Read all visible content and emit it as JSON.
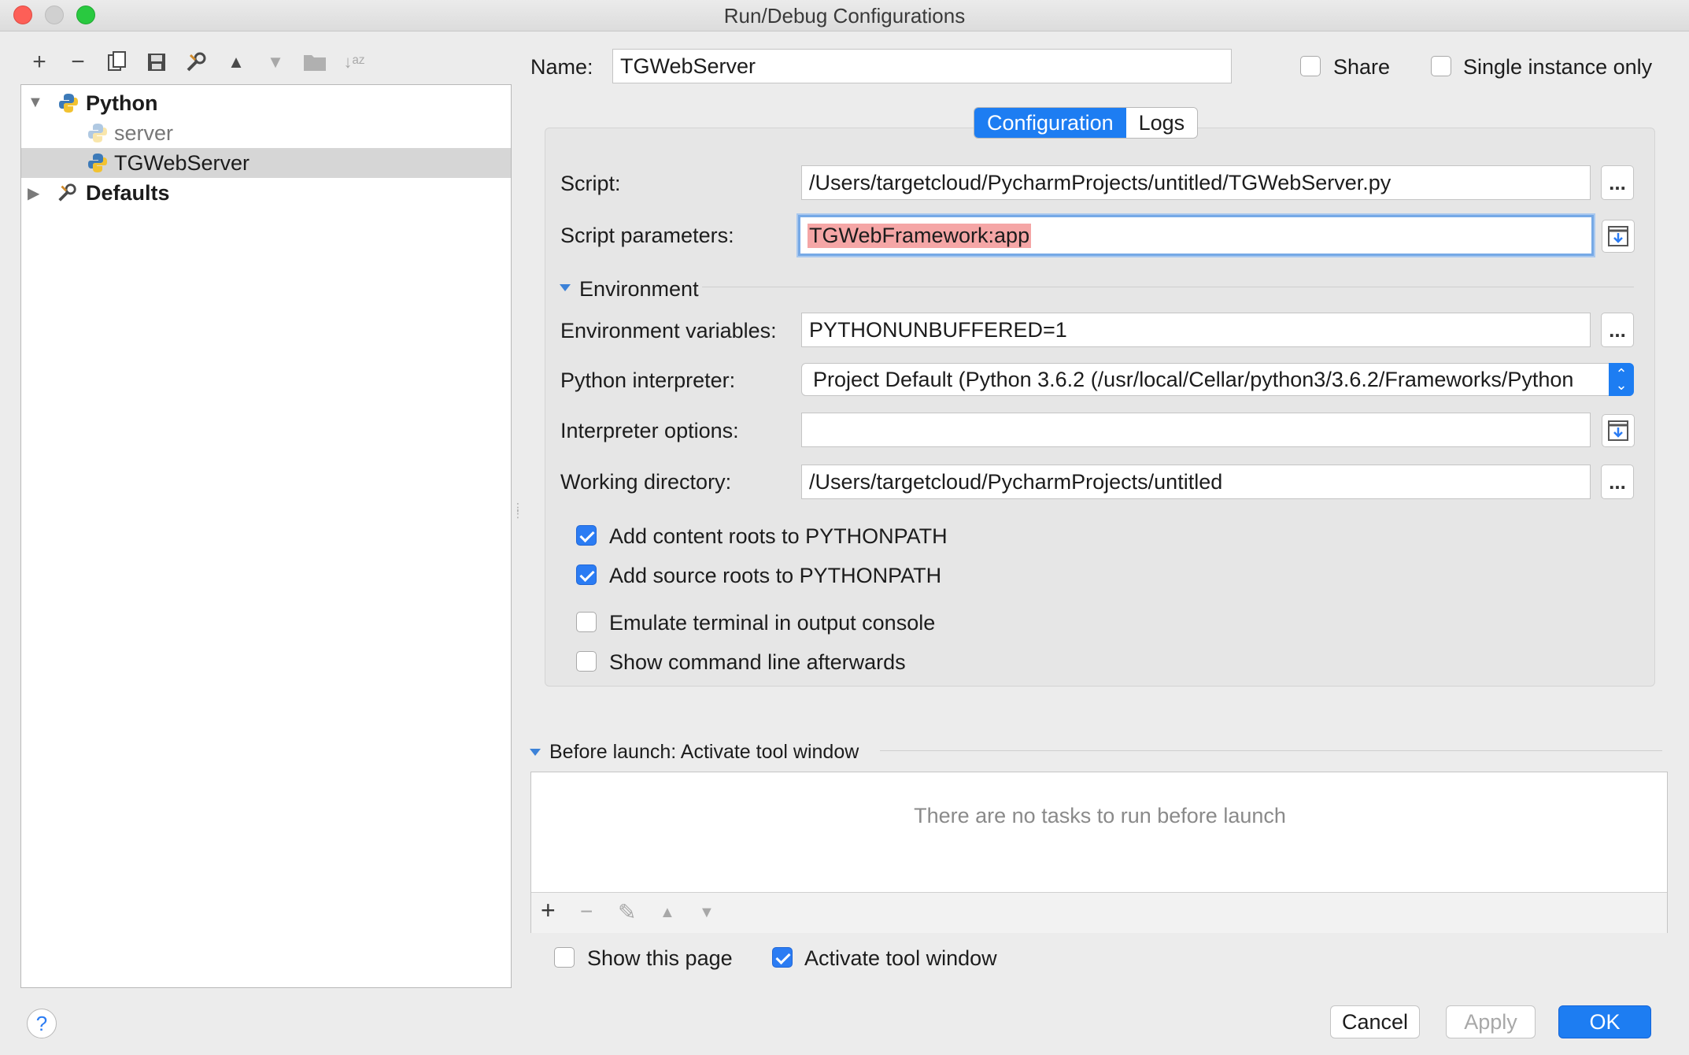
{
  "window": {
    "title": "Run/Debug Configurations"
  },
  "toolbar": {
    "icons": [
      "add-icon",
      "remove-icon",
      "copy-icon",
      "save-icon",
      "wrench-icon",
      "move-up-icon",
      "move-down-icon",
      "folder-icon",
      "sort-icon"
    ]
  },
  "tree": {
    "python_label": "Python",
    "server_label": "server",
    "tgweb_label": "TGWebServer",
    "defaults_label": "Defaults"
  },
  "header": {
    "name_label": "Name:",
    "name_value": "TGWebServer",
    "share_label": "Share",
    "share_checked": false,
    "single_instance_label": "Single instance only",
    "single_instance_checked": false
  },
  "tabs": [
    {
      "label": "Configuration",
      "active": true
    },
    {
      "label": "Logs",
      "active": false
    }
  ],
  "config": {
    "script_label": "Script:",
    "script_value": "/Users/targetcloud/PycharmProjects/untitled/TGWebServer.py",
    "params_label": "Script parameters:",
    "params_value": "TGWebFramework:app",
    "environment_label": "Environment",
    "env_vars_label": "Environment variables:",
    "env_vars_value": "PYTHONUNBUFFERED=1",
    "interpreter_label": "Python interpreter:",
    "interpreter_value": "Project Default (Python 3.6.2 (/usr/local/Cellar/python3/3.6.2/Frameworks/Python",
    "interp_options_label": "Interpreter options:",
    "interp_options_value": "",
    "workdir_label": "Working directory:",
    "workdir_value": "/Users/targetcloud/PycharmProjects/untitled",
    "checks": [
      {
        "label": "Add content roots to PYTHONPATH",
        "checked": true
      },
      {
        "label": "Add source roots to PYTHONPATH",
        "checked": true
      },
      {
        "label": "Emulate terminal in output console",
        "checked": false
      },
      {
        "label": "Show command line afterwards",
        "checked": false
      }
    ],
    "more_button": "..."
  },
  "before_launch": {
    "title": "Before launch: Activate tool window",
    "empty_text": "There are no tasks to run before launch",
    "show_page_label": "Show this page",
    "show_page_checked": false,
    "activate_label": "Activate tool window",
    "activate_checked": true
  },
  "footer": {
    "help": "?",
    "cancel": "Cancel",
    "apply": "Apply",
    "ok": "OK"
  },
  "colors": {
    "accent": "#1d7df2",
    "highlight": "#f5a6a6"
  }
}
